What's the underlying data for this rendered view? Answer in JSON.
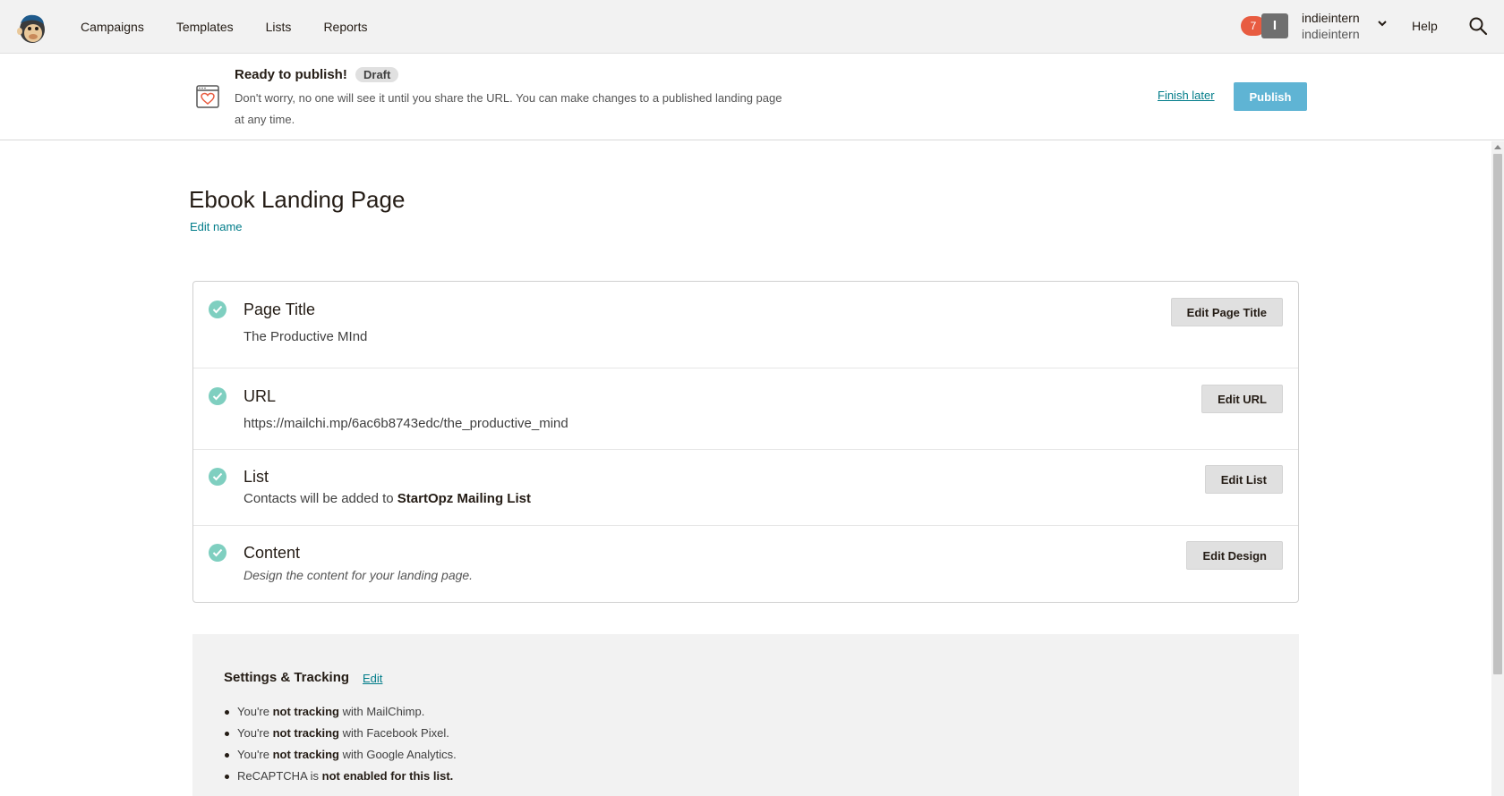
{
  "nav": {
    "links": [
      "Campaigns",
      "Templates",
      "Lists",
      "Reports"
    ],
    "notification_count": "7",
    "avatar_initial": "I",
    "user_name": "indieintern",
    "org_name": "indieintern",
    "help": "Help"
  },
  "publish_bar": {
    "title": "Ready to publish!",
    "badge": "Draft",
    "description": "Don't worry, no one will see it until you share the URL. You can make changes to a published landing page at any time.",
    "finish_later": "Finish later",
    "publish": "Publish"
  },
  "page": {
    "title": "Ebook Landing Page",
    "edit_name": "Edit name"
  },
  "checklist": {
    "page_title": {
      "label": "Page Title",
      "value": "The Productive MInd",
      "button": "Edit Page Title"
    },
    "url": {
      "label": "URL",
      "value": "https://mailchi.mp/6ac6b8743edc/the_productive_mind",
      "button": "Edit URL"
    },
    "list": {
      "label": "List",
      "value_prefix": "Contacts will be added to ",
      "value_strong": "StartOpz Mailing List",
      "button": "Edit List"
    },
    "content": {
      "label": "Content",
      "value": "Design the content for your landing page.",
      "button": "Edit Design"
    }
  },
  "settings": {
    "title": "Settings & Tracking",
    "edit": "Edit",
    "items": [
      {
        "pre": "You're ",
        "strong": "not tracking",
        "post": " with MailChimp."
      },
      {
        "pre": "You're ",
        "strong": "not tracking",
        "post": " with Facebook Pixel."
      },
      {
        "pre": "You're ",
        "strong": "not tracking",
        "post": " with Google Analytics."
      },
      {
        "pre": "ReCAPTCHA is ",
        "strong": "not enabled for this list.",
        "post": ""
      }
    ]
  },
  "colors": {
    "accent_link": "#007c89",
    "publish_button": "#5fb4d4",
    "check": "#7fcfc0",
    "notification": "#e85c41"
  },
  "icons": [
    "mailchimp-logo-icon",
    "chevron-down-icon",
    "search-icon",
    "landing-page-icon",
    "check-icon"
  ]
}
